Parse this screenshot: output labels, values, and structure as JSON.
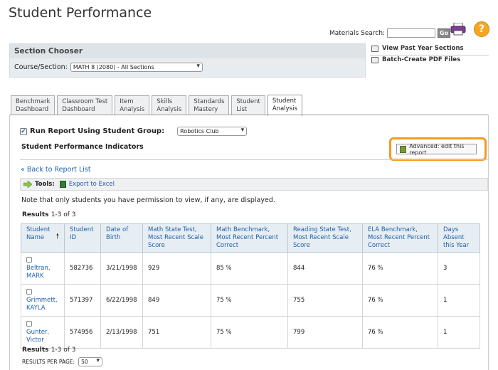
{
  "page": {
    "title": "Student Performance"
  },
  "materials_search": {
    "label": "Materials Search:",
    "value": "",
    "button": "Go"
  },
  "section_chooser": {
    "header": "Section Chooser",
    "label": "Course/Section:",
    "selected": "MATH 8 (2080) - All Sections"
  },
  "right_links": [
    {
      "label": "View Past Year Sections"
    },
    {
      "label": "Batch-Create PDF Files"
    }
  ],
  "tabs": [
    {
      "line1": "Benchmark",
      "line2": "Dashboard"
    },
    {
      "line1": "Classroom Test",
      "line2": "Dashboard"
    },
    {
      "line1": "Item",
      "line2": "Analysis"
    },
    {
      "line1": "Skills",
      "line2": "Analysis"
    },
    {
      "line1": "Standards",
      "line2": "Mastery"
    },
    {
      "line1": "Student",
      "line2": "List"
    },
    {
      "line1": "Student",
      "line2": "Analysis"
    }
  ],
  "run_report": {
    "label": "Run Report Using Student Group:",
    "checked": true,
    "group": "Robotics Club"
  },
  "indicators_title": "Student Performance Indicators",
  "advanced_button": "Advanced: edit this report",
  "back_link": "« Back to Report List",
  "toolbar": {
    "tools_label": "Tools:",
    "export_label": "Export to Excel"
  },
  "note": "Note that only students you have permission to view, if any, are displayed.",
  "results": {
    "label": "Results",
    "range": "1-3 of 3"
  },
  "table": {
    "headers": {
      "name1": "Student",
      "name2": "Name",
      "id1": "Student",
      "id2": "ID",
      "dob1": "Date of",
      "dob2": "Birth",
      "math_state": "Math State Test, Most Recent Scale Score",
      "math_bench": "Math Benchmark, Most Recent Percent Correct",
      "reading_state": "Reading State Test, Most Recent Scale Score",
      "ela_bench": "ELA Benchmark, Most Recent Percent Correct",
      "days_absent": "Days Absent this Year"
    },
    "rows": [
      {
        "last": "Beltran,",
        "first": "MARK",
        "id": "582736",
        "dob": "3/21/1998",
        "math_state": "929",
        "math_bench": "85 %",
        "reading_state": "844",
        "ela_bench": "76 %",
        "days_absent": "3"
      },
      {
        "last": "Grimmett,",
        "first": "KAYLA",
        "id": "571397",
        "dob": "6/22/1998",
        "math_state": "849",
        "math_bench": "75 %",
        "reading_state": "755",
        "ela_bench": "76 %",
        "days_absent": "1"
      },
      {
        "last": "Gunter,",
        "first": "Victor",
        "id": "574956",
        "dob": "2/13/1998",
        "math_state": "751",
        "math_bench": "75 %",
        "reading_state": "799",
        "ela_bench": "76 %",
        "days_absent": "1"
      }
    ]
  },
  "per_page": {
    "label": "RESULTS PER PAGE:",
    "value": "50"
  },
  "colors": {
    "accent_highlight": "#f49b21",
    "link": "#1f5fa8",
    "help": "#f5a623"
  }
}
